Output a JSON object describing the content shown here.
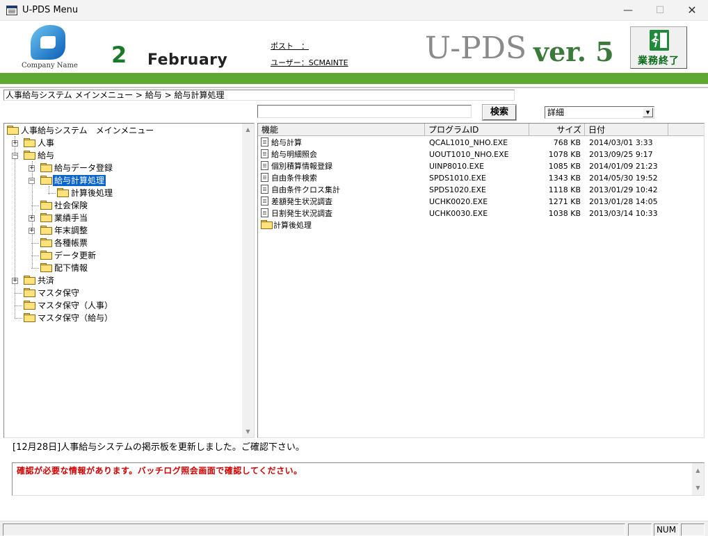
{
  "window": {
    "title": "U-PDS  Menu",
    "minimize": "—",
    "maximize": "☐",
    "close": "✕"
  },
  "header": {
    "company_name": "Company Name",
    "day": "2",
    "month": "February",
    "post_label": "ポスト　：",
    "user_label": "ユーザー：SCMAINTE",
    "brand_main": "U-PDS",
    "brand_version": "ver. 5",
    "exit_button": "業務終了",
    "accent_color": "#5fa832"
  },
  "breadcrumb": "人事給与システム メインメニュー > 給与 > 給与計算処理",
  "search": {
    "value": "",
    "button": "検索"
  },
  "view_select": {
    "selected": "詳細"
  },
  "tree": [
    {
      "label": "人事給与システム　メインメニュー",
      "level": 0,
      "expander": ""
    },
    {
      "label": "人事",
      "level": 1,
      "expander": "+"
    },
    {
      "label": "給与",
      "level": 1,
      "expander": "−"
    },
    {
      "label": "給与データ登録",
      "level": 2,
      "expander": "+"
    },
    {
      "label": "給与計算処理",
      "level": 2,
      "expander": "−",
      "selected": true
    },
    {
      "label": "計算後処理",
      "level": 3,
      "expander": ""
    },
    {
      "label": "社会保険",
      "level": 2,
      "expander": ""
    },
    {
      "label": "業績手当",
      "level": 2,
      "expander": "+"
    },
    {
      "label": "年末調整",
      "level": 2,
      "expander": "+"
    },
    {
      "label": "各種帳票",
      "level": 2,
      "expander": ""
    },
    {
      "label": "データ更新",
      "level": 2,
      "expander": ""
    },
    {
      "label": "配下情報",
      "level": 2,
      "expander": ""
    },
    {
      "label": "共済",
      "level": 1,
      "expander": "+"
    },
    {
      "label": "マスタ保守",
      "level": 1,
      "expander": ""
    },
    {
      "label": "マスタ保守（人事）",
      "level": 1,
      "expander": ""
    },
    {
      "label": "マスタ保守（給与）",
      "level": 1,
      "expander": ""
    }
  ],
  "list": {
    "columns": [
      "機能",
      "プログラムID",
      "サイズ",
      "日付"
    ],
    "rows": [
      {
        "name": "給与計算",
        "program": "QCAL1010_NHO.EXE",
        "size": "768 KB",
        "date": "2014/03/01 3:33",
        "icon": "program-icon"
      },
      {
        "name": "給与明細照会",
        "program": "UOUT1010_NHO.EXE",
        "size": "1078 KB",
        "date": "2013/09/25 9:17",
        "icon": "program-icon"
      },
      {
        "name": "個別積算情報登録",
        "program": "UINP8010.EXE",
        "size": "1085 KB",
        "date": "2014/01/09 21:23",
        "icon": "program-icon"
      },
      {
        "name": "自由条件検索",
        "program": "SPDS1010.EXE",
        "size": "1343 KB",
        "date": "2014/05/30 19:52",
        "icon": "program-icon"
      },
      {
        "name": "自由条件クロス集計",
        "program": "SPDS1020.EXE",
        "size": "1118 KB",
        "date": "2013/01/29 10:42",
        "icon": "program-icon"
      },
      {
        "name": "差額発生状況調査",
        "program": "UCHK0020.EXE",
        "size": "1271 KB",
        "date": "2013/01/28 14:05",
        "icon": "program-icon"
      },
      {
        "name": "日割発生状況調査",
        "program": "UCHK0030.EXE",
        "size": "1038 KB",
        "date": "2013/03/14 10:33",
        "icon": "program-icon"
      },
      {
        "name": "計算後処理",
        "program": "",
        "size": "",
        "date": "",
        "icon": "folder-icon"
      }
    ]
  },
  "bulletin": "[12月28日]人事給与システムの掲示板を更新しました。ご確認下さい。",
  "message": "確認が必要な情報があります。バッチログ照会画面で確認してください。",
  "status": {
    "num": "NUM"
  }
}
